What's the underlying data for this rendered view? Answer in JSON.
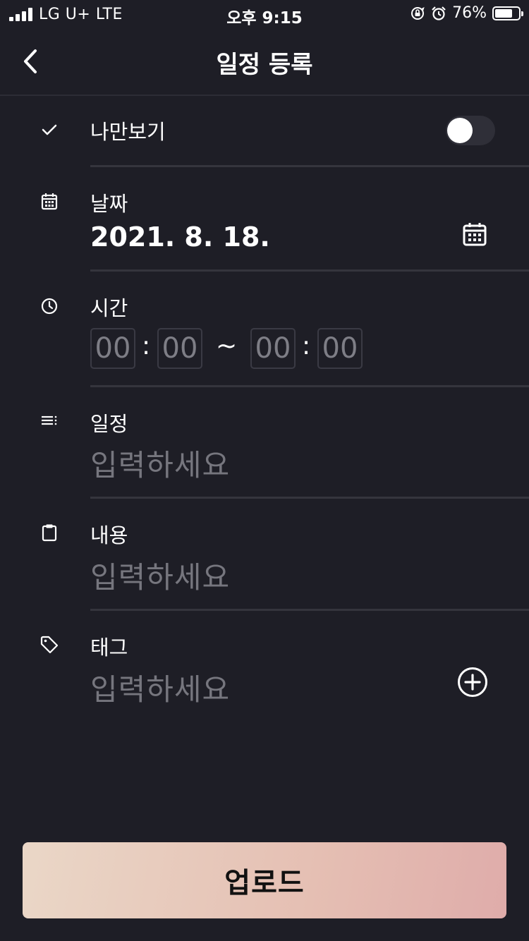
{
  "status_bar": {
    "carrier": "LG U+   LTE",
    "time": "오후 9:15",
    "battery_percent": "76%",
    "battery_level": 0.76
  },
  "header": {
    "title": "일정 등록",
    "back_icon": "chevron-left-icon"
  },
  "private_row": {
    "icon": "check-icon",
    "label": "나만보기",
    "toggle_on": false
  },
  "date_row": {
    "icon": "calendar-icon",
    "label": "날짜",
    "value": "2021. 8. 18."
  },
  "time_row": {
    "icon": "clock-icon",
    "label": "시간",
    "start_hour": "00",
    "start_minute": "00",
    "end_hour": "00",
    "end_minute": "00",
    "colon": ":",
    "tilde": "~"
  },
  "schedule_row": {
    "icon": "list-icon",
    "label": "일정",
    "placeholder": "입력하세요"
  },
  "content_row": {
    "icon": "clipboard-icon",
    "label": "내용",
    "placeholder": "입력하세요"
  },
  "tag_row": {
    "icon": "tag-icon",
    "label": "태그",
    "placeholder": "입력하세요",
    "add_icon": "plus-circle-icon"
  },
  "upload_button": {
    "label": "업로드"
  },
  "colors": {
    "background": "#1e1e26",
    "divider": "#35353d",
    "placeholder": "#76767e",
    "button_gradient_start": "#ead7c7",
    "button_gradient_end": "#dfacaa"
  }
}
